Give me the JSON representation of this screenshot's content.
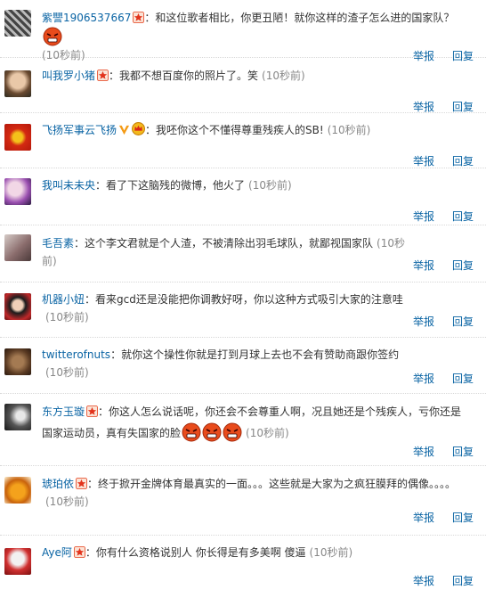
{
  "comments": [
    {
      "name": "紫譻1906537667",
      "text": "：和这位歌者相比，你更丑陋！就你这样的渣子怎么进的国家队？",
      "time": "(10秒前)",
      "report": "举报",
      "reply": "回复"
    },
    {
      "name": "叫我罗小猪",
      "text": "：我都不想百度你的照片了。笑",
      "time": "(10秒前)",
      "report": "举报",
      "reply": "回复"
    },
    {
      "name": "飞扬军事云飞扬",
      "text": "：我呸你这个不懂得尊重残疾人的SB!",
      "time": "(10秒前)",
      "report": "举报",
      "reply": "回复"
    },
    {
      "name": "我叫未未央",
      "text": "：看了下这脑残的微博，他火了",
      "time": "(10秒前)",
      "report": "举报",
      "reply": "回复"
    },
    {
      "name": "毛吾素",
      "text": "：这个李文君就是个人渣，不被清除出羽毛球队，就鄙视国家队",
      "time": "(10秒前)",
      "report": "举报",
      "reply": "回复"
    },
    {
      "name": "机器小妞",
      "text": "：看来gcd还是没能把你调教好呀，你以这种方式吸引大家的注意哇",
      "time": "(10秒前)",
      "report": "举报",
      "reply": "回复"
    },
    {
      "name": "twitterofnuts",
      "text": "：就你这个操性你就是打到月球上去也不会有赞助商跟你签约",
      "time": "(10秒前)",
      "report": "举报",
      "reply": "回复"
    },
    {
      "name": "东方玉璇",
      "text": "：你这人怎么说话呢，你还会不会尊重人啊，况且她还是个残疾人，亏你还是国家运动员，真有失国家的脸",
      "time": "(10秒前)",
      "report": "举报",
      "reply": "回复"
    },
    {
      "name": "琥珀依",
      "text": "：终于掀开金牌体育最真实的一面。。。这些就是大家为之疯狂膜拜的偶像。。。。",
      "time": "(10秒前)",
      "report": "举报",
      "reply": "回复"
    },
    {
      "name": "Aye阿",
      "text": "：你有什么资格说别人 你长得是有多美啊 傻逼",
      "time": "(10秒前)",
      "report": "举报",
      "reply": "回复"
    }
  ],
  "colors": {
    "link": "#0a64a4",
    "text": "#333333",
    "time": "#888888",
    "separator": "#d8d8d8"
  }
}
